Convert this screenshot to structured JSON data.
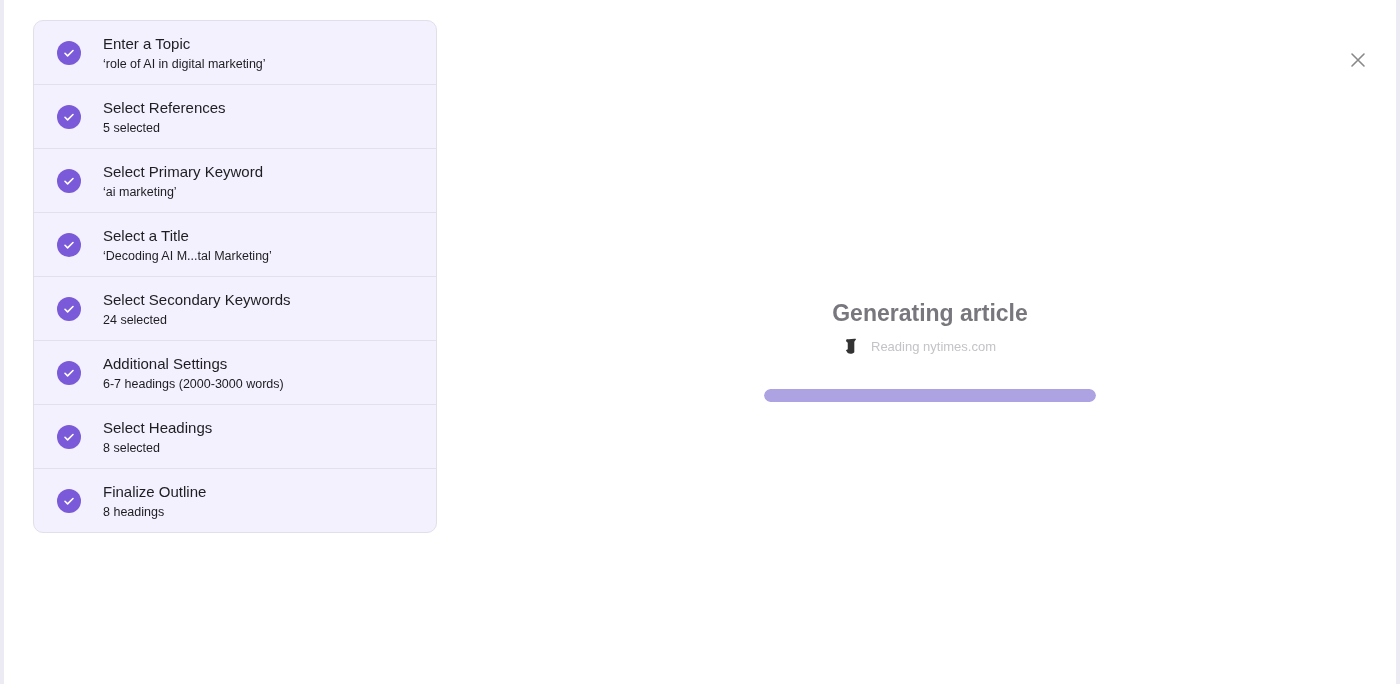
{
  "steps": [
    {
      "title": "Enter a Topic",
      "detail": "‘role of AI in digital marketing’",
      "done": true
    },
    {
      "title": "Select References",
      "detail": "5 selected",
      "done": true
    },
    {
      "title": "Select Primary Keyword",
      "detail": "‘ai marketing’",
      "done": true
    },
    {
      "title": "Select a Title",
      "detail": "‘Decoding AI M...tal Marketing’",
      "done": true
    },
    {
      "title": "Select Secondary Keywords",
      "detail": "24 selected",
      "done": true
    },
    {
      "title": "Additional Settings",
      "detail": "6-7 headings (2000-3000 words)",
      "done": true
    },
    {
      "title": "Select Headings",
      "detail": "8 selected",
      "done": true
    },
    {
      "title": "Finalize Outline",
      "detail": "8 headings",
      "done": true
    }
  ],
  "status": {
    "heading": "Generating article",
    "source": "Reading nytimes.com",
    "level": 1
  }
}
